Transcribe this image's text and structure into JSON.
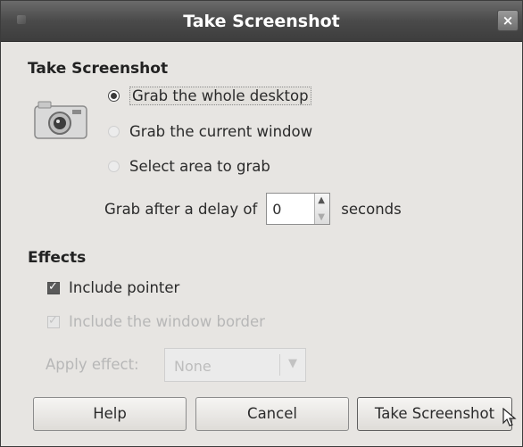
{
  "window": {
    "title": "Take Screenshot",
    "close_glyph": "×"
  },
  "capture": {
    "heading": "Take Screenshot",
    "camera_icon": "camera-icon",
    "options": [
      {
        "label": "Grab the whole desktop",
        "selected": true
      },
      {
        "label": "Grab the current window",
        "selected": false
      },
      {
        "label": "Select area to grab",
        "selected": false
      }
    ],
    "delay_before": "Grab after a delay of",
    "delay_value": "0",
    "delay_after": "seconds"
  },
  "effects": {
    "heading": "Effects",
    "include_pointer": {
      "label": "Include pointer",
      "checked": true,
      "enabled": true
    },
    "include_border": {
      "label": "Include the window border",
      "checked": true,
      "enabled": false
    },
    "apply_effect_label": "Apply effect:",
    "apply_effect_value": "None"
  },
  "buttons": {
    "help": "Help",
    "cancel": "Cancel",
    "take": "Take Screenshot"
  },
  "colors": {
    "titlebar": "#4a4a4a",
    "dialog_bg": "#e7e5e2",
    "disabled_text": "#b7b7b7"
  }
}
